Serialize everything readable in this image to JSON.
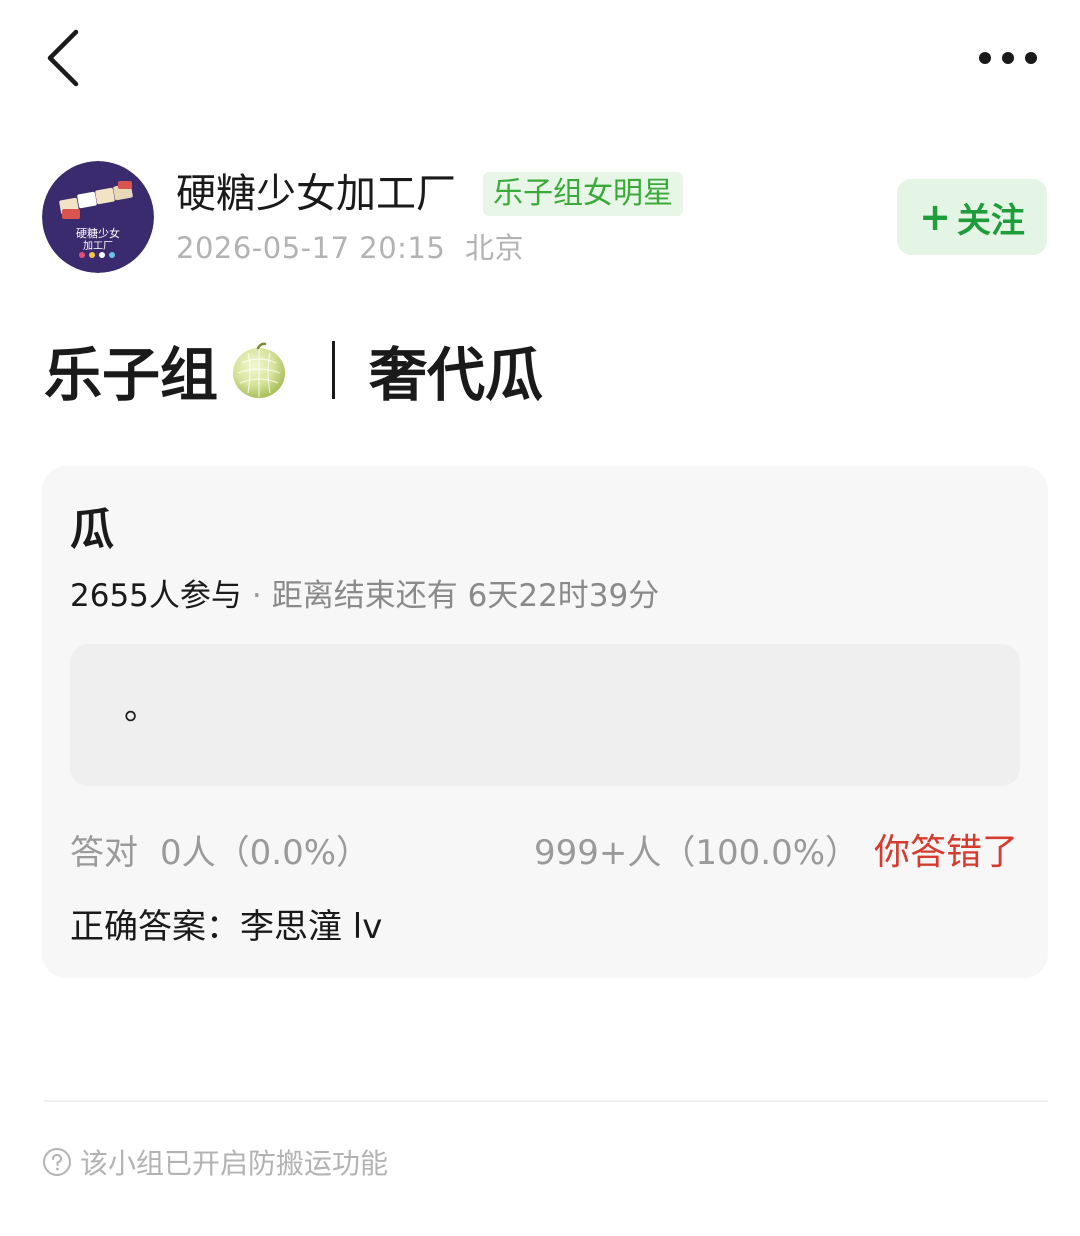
{
  "header": {
    "back_icon": "chevron-left-icon",
    "more_icon": "more-dots-icon"
  },
  "author": {
    "name": "硬糖少女加工厂",
    "tag": "乐子组女明星",
    "time": "2026-05-17 20:15",
    "location": "北京",
    "avatar_text_line1": "硬糖少女",
    "avatar_text_line2": "加工厂",
    "follow_plus": "+",
    "follow_label": "关注"
  },
  "post": {
    "title_part1": "乐子组",
    "title_icon": "melon-icon",
    "title_part2": "奢代瓜"
  },
  "quiz": {
    "title": "瓜",
    "participants": "2655人参与",
    "separator": "·",
    "remaining_label": "距离结束还有",
    "remaining_time": "6天22时39分",
    "option_text": "。",
    "correct_label": "答对",
    "correct_value": "0人（0.0%）",
    "wrong_value": "999+人（100.0%）",
    "wrong_flag": "你答错了",
    "answer_label": "正确答案：",
    "answer_value": "李思潼 lv"
  },
  "footer": {
    "icon": "help-circle-icon",
    "note": "该小组已开启防搬运功能"
  },
  "colors": {
    "accent_green": "#1f9d3a",
    "tag_green": "#3caa3a",
    "wrong_red": "#d63b2f",
    "avatar_purple": "#3a2a6e"
  }
}
